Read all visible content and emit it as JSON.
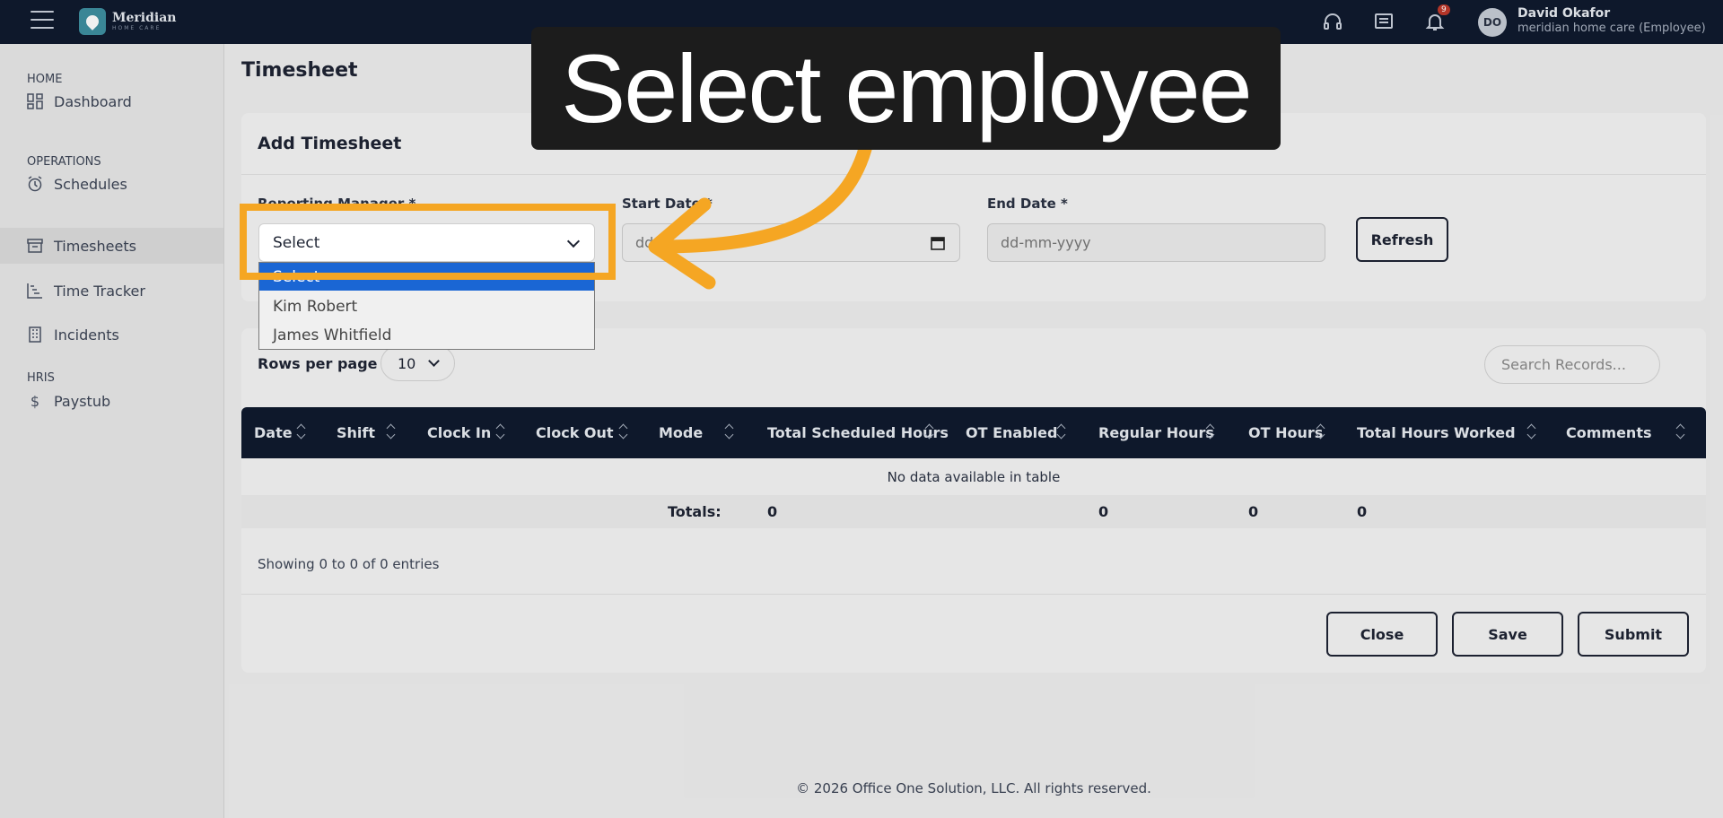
{
  "topbar": {
    "logo_title": "Meridian",
    "logo_sub": "HOME CARE",
    "notification_count": "9",
    "avatar_initials": "DO",
    "user_name": "David Okafor",
    "user_role": "meridian home care (Employee)"
  },
  "sidebar": {
    "sections": [
      "HOME",
      "OPERATIONS",
      "HRIS"
    ],
    "items": [
      {
        "label": "Dashboard",
        "icon": "dashboard-icon"
      },
      {
        "label": "Schedules",
        "icon": "alarm-clock-icon"
      },
      {
        "label": "Timesheets",
        "icon": "archive-icon"
      },
      {
        "label": "Time Tracker",
        "icon": "gantt-icon"
      },
      {
        "label": "Incidents",
        "icon": "building-icon"
      },
      {
        "label": "Paystub",
        "icon": "dollar-icon"
      }
    ]
  },
  "page": {
    "title": "Timesheet"
  },
  "add_timesheet": {
    "title": "Add Timesheet",
    "reporting_manager_label": "Reporting Manager *",
    "start_date_label": "Start Date *",
    "end_date_label": "End Date *",
    "date_placeholder": "dd-mm-yyyy",
    "start_date_visible": "dd",
    "refresh_label": "Refresh",
    "select_value": "Select",
    "options": [
      "Select",
      "Kim Robert",
      "James Whitfield"
    ]
  },
  "records": {
    "rows_per_page_label": "Rows per page",
    "rows_per_page_value": "10",
    "search_placeholder": "Search Records...",
    "columns": [
      "Date",
      "Shift",
      "Clock In",
      "Clock Out",
      "Mode",
      "Total Scheduled Hours",
      "OT Enabled",
      "Regular Hours",
      "OT Hours",
      "Total Hours Worked",
      "Comments"
    ],
    "empty_text": "No data available in table",
    "totals_label": "Totals:",
    "totals": [
      "0",
      "0",
      "0",
      "0"
    ],
    "showing_text": "Showing 0 to 0 of 0 entries",
    "close_label": "Close",
    "save_label": "Save",
    "submit_label": "Submit"
  },
  "footer": {
    "text": "© 2026 Office One Solution, LLC. All rights reserved."
  },
  "callout": {
    "text": "Select employee"
  },
  "colors": {
    "topbar": "#0f1a2e",
    "highlight": "#f5a623",
    "selected_option": "#1a66d4"
  }
}
